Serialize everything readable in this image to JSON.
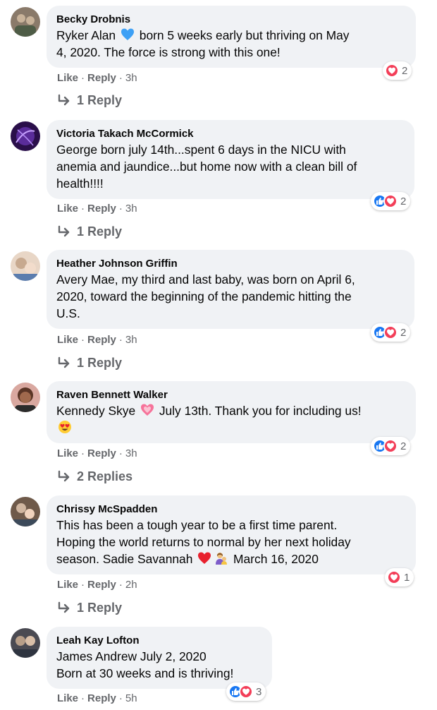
{
  "ui": {
    "like_label": "Like",
    "reply_label": "Reply",
    "separator": "·"
  },
  "comments": [
    {
      "author": "Becky Drobnis",
      "lines": [
        [
          "Ryker Alan ",
          "blue-heart-emoji",
          " born 5 weeks early but thriving on May"
        ],
        [
          "4, 2020. The force is strong with this one!"
        ]
      ],
      "time": "3h",
      "reactions": [
        "love"
      ],
      "reaction_count": "2",
      "replies": "1 Reply",
      "avatar_colors": [
        "#8a7a6a",
        "#c9b39a"
      ]
    },
    {
      "author": "Victoria Takach McCormick",
      "lines": [
        [
          "George born july 14th...spent 6 days in the NICU with"
        ],
        [
          "anemia and jaundice...but home now with a clean bill of"
        ],
        [
          "health!!!!"
        ]
      ],
      "time": "3h",
      "reactions": [
        "like",
        "love"
      ],
      "reaction_count": "2",
      "replies": "1 Reply",
      "avatar_colors": [
        "#2a0f4a",
        "#7b3fd0"
      ]
    },
    {
      "author": "Heather Johnson Griffin",
      "lines": [
        [
          "Avery Mae, my third and last baby, was born on April 6,"
        ],
        [
          "2020, toward the beginning of the pandemic hitting the"
        ],
        [
          "U.S."
        ]
      ],
      "time": "3h",
      "reactions": [
        "like",
        "love"
      ],
      "reaction_count": "2",
      "replies": "1 Reply",
      "avatar_colors": [
        "#c7a98f",
        "#e8d6c6"
      ]
    },
    {
      "author": "Raven Bennett Walker",
      "lines": [
        [
          "Kennedy Skye ",
          "sparkling-heart-emoji",
          " July 13th. Thank you for including us!"
        ],
        [
          "heart-eyes-emoji"
        ]
      ],
      "time": "3h",
      "reactions": [
        "like",
        "love"
      ],
      "reaction_count": "2",
      "replies": "2 Replies",
      "avatar_colors": [
        "#5a3526",
        "#a0694d"
      ]
    },
    {
      "author": "Chrissy McSpadden",
      "lines": [
        [
          "This has been a tough year to be a first time parent."
        ],
        [
          "Hoping the world returns to normal by her next holiday"
        ],
        [
          "season. Sadie Savannah ",
          "red-heart-emoji",
          "parent-baby-emoji",
          " March 16, 2020"
        ]
      ],
      "time": "2h",
      "reactions": [
        "love"
      ],
      "reaction_count": "1",
      "replies": "1 Reply",
      "avatar_colors": [
        "#6f5a4a",
        "#d0b6a0"
      ]
    },
    {
      "author": "Leah Kay Lofton",
      "lines": [
        [
          "James Andrew July 2, 2020"
        ],
        [
          "Born at 30 weeks and is thriving!"
        ]
      ],
      "time": "5h",
      "reactions": [
        "like",
        "love"
      ],
      "reaction_count": "3",
      "replies": "",
      "avatar_colors": [
        "#4a4a52",
        "#b79e88"
      ]
    }
  ]
}
